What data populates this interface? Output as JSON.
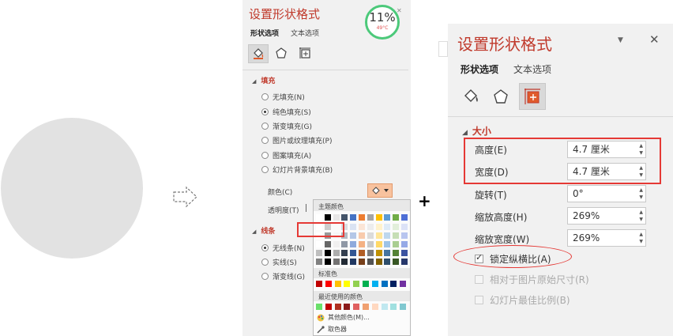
{
  "flow": {
    "plus": "+"
  },
  "panel1": {
    "title": "设置形状格式",
    "tabs": [
      "形状选项",
      "文本选项"
    ],
    "fill_section": "填充",
    "fill_options": [
      "无填充(N)",
      "纯色填充(S)",
      "渐变填充(G)",
      "图片或纹理填充(P)",
      "图案填充(A)",
      "幻灯片背景填充(B)"
    ],
    "fill_selected_index": 1,
    "color_label": "颜色(C)",
    "transparency_label": "透明度(T)",
    "line_section": "线条",
    "line_options": [
      "无线条(N)",
      "实线(S)",
      "渐变线(G)"
    ],
    "line_selected_index": 0
  },
  "widget": {
    "percent": "11%",
    "temp": "49°C"
  },
  "picker": {
    "theme_colors_label": "主题颜色",
    "standard_colors_label": "标准色",
    "recent_colors_label": "最近使用的颜色",
    "more_colors": "其他颜色(M)...",
    "eyedropper": "取色器",
    "theme_top": [
      "#ffffff",
      "#000000",
      "#e7e6e6",
      "#44546a",
      "#4472c4",
      "#ed7d31",
      "#a5a5a5",
      "#ffc000",
      "#5b9bd5",
      "#70ad47",
      "#4e6fd6"
    ],
    "standard": [
      "#c00000",
      "#ff0000",
      "#ffc000",
      "#ffff00",
      "#92d050",
      "#00b050",
      "#00b0f0",
      "#0070c0",
      "#002060",
      "#7030a0"
    ],
    "recent": [
      "#6ae06a",
      "#c00000",
      "#b03020",
      "#8b1a1a",
      "#e06060",
      "#f0a070",
      "#ffd8c0",
      "#c0e8f0",
      "#a0e0e0",
      "#80c8d0"
    ]
  },
  "panel2": {
    "title": "设置形状格式",
    "tabs": [
      "形状选项",
      "文本选项"
    ],
    "size_section": "大小",
    "rows": [
      {
        "label": "高度(E)",
        "value": "4.7 厘米"
      },
      {
        "label": "宽度(D)",
        "value": "4.7 厘米"
      },
      {
        "label": "旋转(T)",
        "value": "0°"
      },
      {
        "label": "缩放高度(H)",
        "value": "269%"
      },
      {
        "label": "缩放宽度(W)",
        "value": "269%"
      }
    ],
    "lock_aspect": "锁定纵横比(A)",
    "relative_original": "相对于图片原始尺寸(R)",
    "best_scale": "幻灯片最佳比例(B)"
  }
}
